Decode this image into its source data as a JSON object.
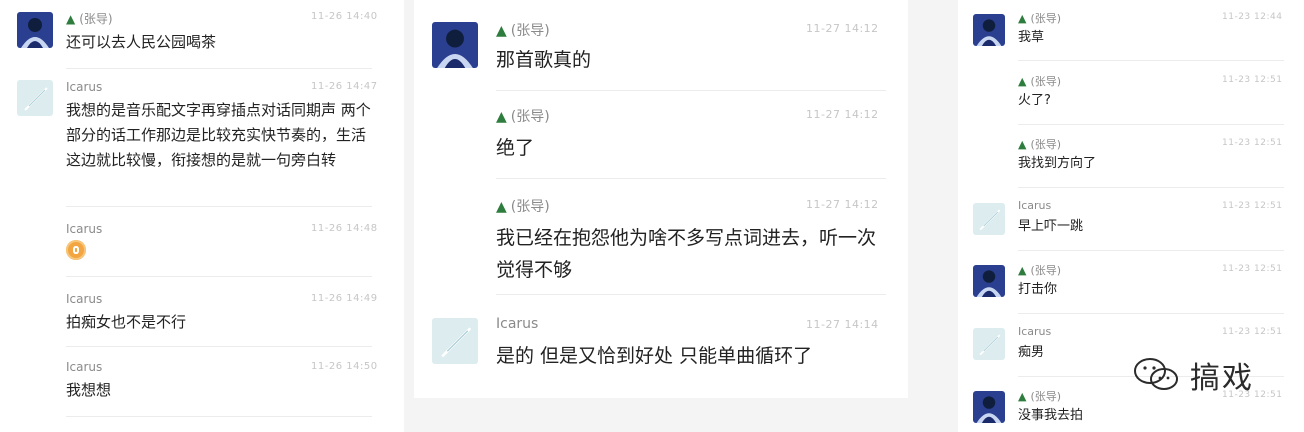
{
  "users": {
    "zhang": "(张导)",
    "icarus": "Icarus",
    "icarus_small": "Icarus"
  },
  "left": {
    "messages": [
      {
        "user": "(张导)",
        "time": "11-26 14:40",
        "text": "还可以去人民公园喝茶"
      },
      {
        "user": "Icarus",
        "time": "11-26 14:47",
        "text": "我想的是音乐配文字再穿插点对话同期声 两个部分的话工作那边是比较充实快节奏的，生活这边就比较慢，衔接想的是就一句旁白转"
      },
      {
        "user": "Icarus",
        "time": "11-26 14:48",
        "text": ""
      },
      {
        "user": "Icarus",
        "time": "11-26 14:49",
        "text": "拍痴女也不是不行"
      },
      {
        "user": "Icarus",
        "time": "11-26 14:50",
        "text": "我想想"
      }
    ]
  },
  "center": {
    "messages": [
      {
        "user": "(张导)",
        "time": "11-27 14:12",
        "text": "那首歌真的"
      },
      {
        "user": "(张导)",
        "time": "11-27 14:12",
        "text": "绝了"
      },
      {
        "user": "(张导)",
        "time": "11-27 14:12",
        "text": "我已经在抱怨他为啥不多写点词进去，听一次觉得不够"
      },
      {
        "user": "Icarus",
        "time": "11-27 14:14",
        "text": "是的 但是又恰到好处 只能单曲循环了"
      }
    ]
  },
  "right": {
    "messages": [
      {
        "user": "(张导)",
        "time": "11-23 12:44",
        "text": "我草"
      },
      {
        "user": "(张导)",
        "time": "11-23 12:51",
        "text": "火了?"
      },
      {
        "user": "(张导)",
        "time": "11-23 12:51",
        "text": "我找到方向了"
      },
      {
        "user": "Icarus",
        "time": "11-23 12:51",
        "text": "早上吓一跳"
      },
      {
        "user": "(张导)",
        "time": "11-23 12:51",
        "text": "打击你"
      },
      {
        "user": "Icarus",
        "time": "11-23 12:51",
        "text": "痴男"
      },
      {
        "user": "(张导)",
        "time": "11-23 12:51",
        "text": "没事我去拍"
      }
    ]
  },
  "watermark": {
    "text": "搞戏"
  },
  "colors": {
    "tree": "#2f7d3e",
    "time": "#c6c6c6",
    "name": "#8a8a8a",
    "text": "#222222"
  },
  "icons": {
    "zhang_avatar": "person-photo-avatar",
    "icarus_avatar": "feather-avatar",
    "tree": "pine-tree-icon",
    "wechat": "wechat-icon"
  }
}
